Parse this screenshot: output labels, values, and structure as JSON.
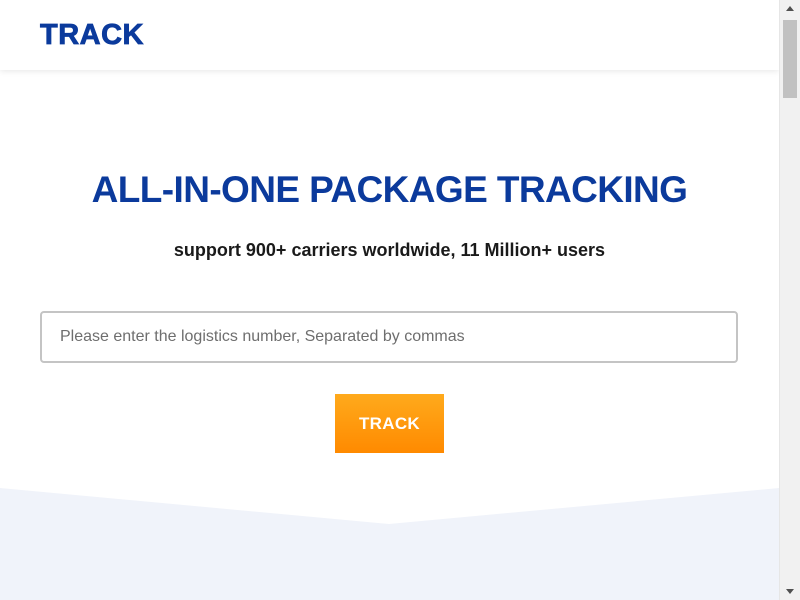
{
  "header": {
    "logo_text": "TRACK"
  },
  "hero": {
    "title": "ALL-IN-ONE PACKAGE TRACKING",
    "subtitle": "support 900+ carriers worldwide, 11 Million+ users"
  },
  "search": {
    "value": "",
    "placeholder": "Please enter the logistics number, Separated by commas",
    "button_label": "TRACK"
  },
  "colors": {
    "brand_blue": "#0b3a9c",
    "accent_orange": "#ff9500",
    "band_background": "#f0f3fa"
  },
  "icons": {
    "scroll_up": "triangle-up-icon",
    "scroll_down": "triangle-down-icon"
  }
}
